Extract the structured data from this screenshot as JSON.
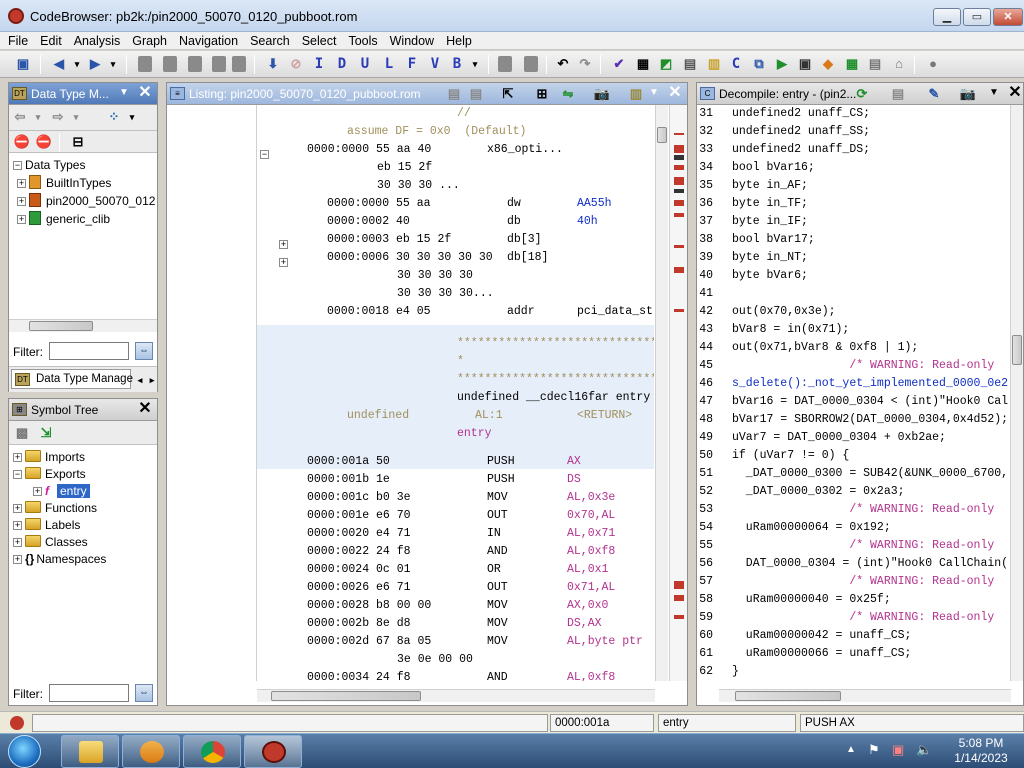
{
  "window": {
    "title": "CodeBrowser: pb2k:/pin2000_50070_0120_pubboot.rom"
  },
  "menu": [
    "File",
    "Edit",
    "Analysis",
    "Graph",
    "Navigation",
    "Search",
    "Select",
    "Tools",
    "Window",
    "Help"
  ],
  "toolbar": {
    "letter_buttons": [
      "I",
      "D",
      "U",
      "L",
      "F",
      "V",
      "B"
    ]
  },
  "datatype_panel": {
    "title": "Data Type M...",
    "tab_label": "Data Type Manage",
    "root": "Data Types",
    "items": [
      "BuiltInTypes",
      "pin2000_50070_012",
      "generic_clib"
    ],
    "filter_label": "Filter:"
  },
  "symbol_tree": {
    "title": "Symbol Tree",
    "items": [
      "Imports",
      "Exports",
      "entry",
      "Functions",
      "Labels",
      "Classes",
      "Namespaces"
    ],
    "filter_label": "Filter:"
  },
  "listing": {
    "title": "Listing:  pin2000_50070_0120_pubboot.rom",
    "rows": [
      {
        "c": "//"
      },
      {
        "c": "assume DF = 0x0  (Default)"
      },
      {
        "a": "0000:0000",
        "b": "55 aa 40",
        "m": "x86_opti..."
      },
      {
        "b": "eb 15 2f"
      },
      {
        "b": "30 30 30 ..."
      },
      {
        "a": "0000:0000",
        "b": "55 aa",
        "m": "dw",
        "o": "AA55h"
      },
      {
        "a": "0000:0002",
        "b": "40",
        "m": "db",
        "o": "40h"
      },
      {
        "a": "0000:0003",
        "b": "eb 15 2f",
        "m": "db[3]"
      },
      {
        "a": "0000:0006",
        "b": "30 30 30 30 30",
        "m": "db[18]"
      },
      {
        "b": "30 30 30 30"
      },
      {
        "b": "30 30 30 30..."
      },
      {
        "a": "0000:0018",
        "b": "e4 05",
        "m": "addr",
        "o": "pci_data_st"
      },
      {
        "stars": "**************************************"
      },
      {
        "stars": "*                                    F"
      },
      {
        "stars": "**************************************"
      },
      {
        "sig": "undefined __cdecl16far entry"
      },
      {
        "ret": "undefined",
        "reg": "AL:1",
        "rv": "<RETURN>"
      },
      {
        "label": "entry"
      },
      {
        "a": "0000:001a",
        "b": "50",
        "m": "PUSH",
        "o": "AX"
      },
      {
        "a": "0000:001b",
        "b": "1e",
        "m": "PUSH",
        "o": "DS"
      },
      {
        "a": "0000:001c",
        "b": "b0 3e",
        "m": "MOV",
        "o": "AL,0x3e"
      },
      {
        "a": "0000:001e",
        "b": "e6 70",
        "m": "OUT",
        "o": "0x70,AL"
      },
      {
        "a": "0000:0020",
        "b": "e4 71",
        "m": "IN",
        "o": "AL,0x71"
      },
      {
        "a": "0000:0022",
        "b": "24 f8",
        "m": "AND",
        "o": "AL,0xf8"
      },
      {
        "a": "0000:0024",
        "b": "0c 01",
        "m": "OR",
        "o": "AL,0x1"
      },
      {
        "a": "0000:0026",
        "b": "e6 71",
        "m": "OUT",
        "o": "0x71,AL"
      },
      {
        "a": "0000:0028",
        "b": "b8 00 00",
        "m": "MOV",
        "o": "AX,0x0"
      },
      {
        "a": "0000:002b",
        "b": "8e d8",
        "m": "MOV",
        "o": "DS,AX"
      },
      {
        "a": "0000:002d",
        "b": "67 8a 05",
        "m": "MOV",
        "o": "AL,byte ptr"
      },
      {
        "b": "3e 0e 00 00"
      },
      {
        "a": "0000:0034",
        "b": "24 f8",
        "m": "AND",
        "o": "AL,0xf8"
      }
    ]
  },
  "decompile": {
    "title": "Decompile: entry - (pin2...",
    "lines": [
      {
        "n": "31",
        "t": "undefined2 unaff_CS;"
      },
      {
        "n": "32",
        "t": "undefined2 unaff_SS;"
      },
      {
        "n": "33",
        "t": "undefined2 unaff_DS;"
      },
      {
        "n": "34",
        "t": "bool bVar16;"
      },
      {
        "n": "35",
        "t": "byte in_AF;"
      },
      {
        "n": "36",
        "t": "byte in_TF;"
      },
      {
        "n": "37",
        "t": "byte in_IF;"
      },
      {
        "n": "38",
        "t": "bool bVar17;"
      },
      {
        "n": "39",
        "t": "byte in_NT;"
      },
      {
        "n": "40",
        "t": "byte bVar6;"
      },
      {
        "n": "41",
        "t": ""
      },
      {
        "n": "42",
        "t": "out(0x70,0x3e);"
      },
      {
        "n": "43",
        "t": "bVar8 = in(0x71);"
      },
      {
        "n": "44",
        "t": "out(0x71,bVar8 & 0xf8 | 1);"
      },
      {
        "n": "45",
        "t": "                 /* WARNING: Read-only"
      },
      {
        "n": "46",
        "t": "s_delete():_not_yet_implemented_0000_0e2"
      },
      {
        "n": "47",
        "t": "bVar16 = DAT_0000_0304 < (int)\"Hook0 Cal"
      },
      {
        "n": "48",
        "t": "bVar17 = SBORROW2(DAT_0000_0304,0x4d52);"
      },
      {
        "n": "49",
        "t": "uVar7 = DAT_0000_0304 + 0xb2ae;"
      },
      {
        "n": "50",
        "t": "if (uVar7 != 0) {"
      },
      {
        "n": "51",
        "t": "  _DAT_0000_0300 = SUB42(&UNK_0000_6700,"
      },
      {
        "n": "52",
        "t": "  _DAT_0000_0302 = 0x2a3;"
      },
      {
        "n": "53",
        "t": "                 /* WARNING: Read-only"
      },
      {
        "n": "54",
        "t": "  uRam00000064 = 0x192;"
      },
      {
        "n": "55",
        "t": "                 /* WARNING: Read-only"
      },
      {
        "n": "56",
        "t": "  DAT_0000_0304 = (int)\"Hook0 CallChain("
      },
      {
        "n": "57",
        "t": "                 /* WARNING: Read-only"
      },
      {
        "n": "58",
        "t": "  uRam00000040 = 0x25f;"
      },
      {
        "n": "59",
        "t": "                 /* WARNING: Read-only"
      },
      {
        "n": "60",
        "t": "  uRam00000042 = unaff_CS;"
      },
      {
        "n": "61",
        "t": "  uRam00000066 = unaff_CS;"
      },
      {
        "n": "62",
        "t": "}"
      }
    ]
  },
  "status": {
    "address": "0000:001a",
    "function": "entry",
    "instruction": "PUSH AX"
  },
  "taskbar": {
    "time": "5:08 PM",
    "date": "1/14/2023"
  }
}
